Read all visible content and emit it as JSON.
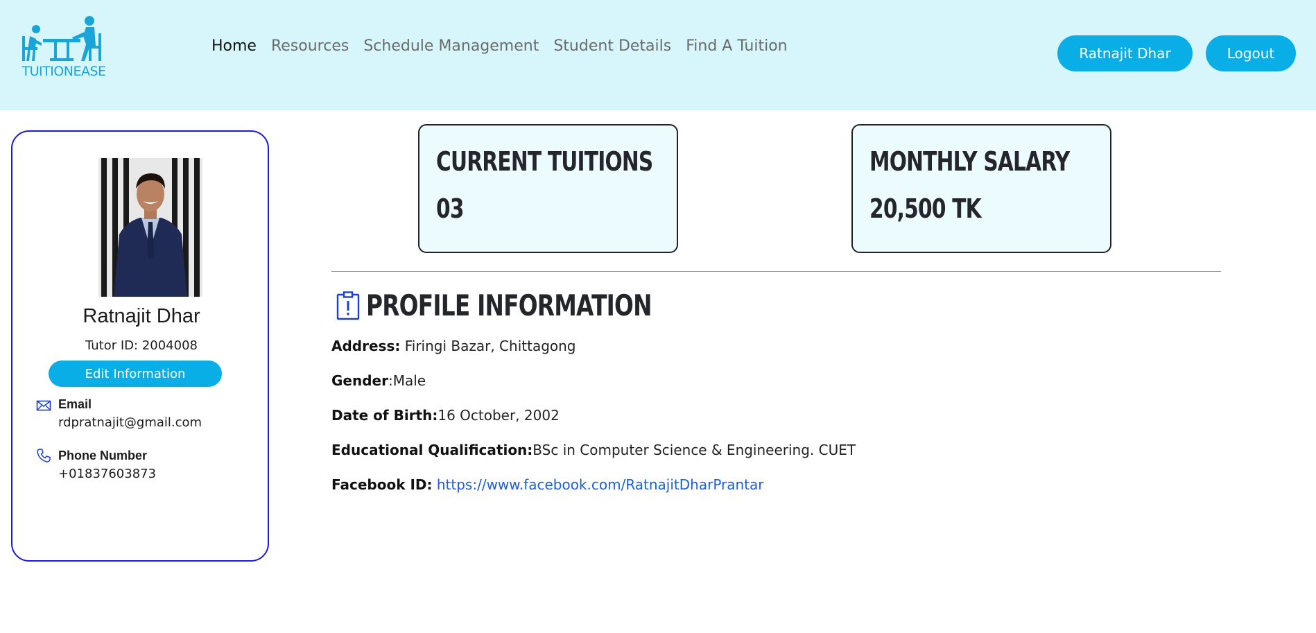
{
  "brand": {
    "logo_text": "TUITIONEASE",
    "accent_color": "#0aaee6",
    "header_bg": "#d6f6fb"
  },
  "nav": {
    "items": [
      {
        "label": "Home",
        "active": true
      },
      {
        "label": "Resources",
        "active": false
      },
      {
        "label": "Schedule Management",
        "active": false
      },
      {
        "label": "Student Details",
        "active": false
      },
      {
        "label": "Find A Tuition",
        "active": false
      }
    ]
  },
  "header": {
    "user_button": "Ratnajit Dhar",
    "logout_button": "Logout"
  },
  "profile_card": {
    "name": "Ratnajit Dhar",
    "tutor_id": "Tutor ID: 2004008",
    "edit_button": "Edit Information",
    "email_label": "Email",
    "email_value": "rdpratnajit@gmail.com",
    "phone_label": "Phone Number",
    "phone_value": "+01837603873",
    "email_icon": "mail-icon",
    "phone_icon": "phone-icon"
  },
  "stats": {
    "current_tuitions_label": "CURRENT TUITIONS",
    "current_tuitions_value": "03",
    "monthly_salary_label": "MONTHLY SALARY",
    "monthly_salary_value": "20,500 TK"
  },
  "profile_info": {
    "title": "PROFILE INFORMATION",
    "icon": "clipboard-alert-icon",
    "address_label": "Address:",
    "address_value": "Firingi Bazar, Chittagong",
    "gender_label": "Gender",
    "gender_value": ":Male",
    "dob_label": "Date of Birth:",
    "dob_value": "16 October, 2002",
    "education_label": "Educational Qualification:",
    "education_value": "BSc in Computer Science & Engineering. CUET",
    "facebook_label": "Facebook ID:",
    "facebook_value": "https://www.facebook.com/RatnajitDharPrantar"
  }
}
